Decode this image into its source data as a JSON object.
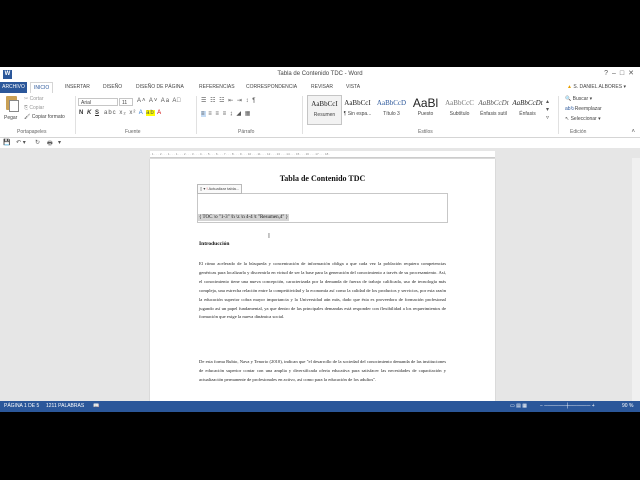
{
  "window": {
    "title": "Tabla de Contenido TDC - Word",
    "app_icon": "W"
  },
  "tabs": {
    "file": "ARCHIVO",
    "items": [
      "INICIO",
      "INSERTAR",
      "DISEÑO",
      "DISEÑO DE PÁGINA",
      "REFERENCIAS",
      "CORRESPONDENCIA",
      "REVISAR",
      "VISTA"
    ],
    "user": "S. DANIEL ALBORES"
  },
  "ribbon": {
    "clipboard": {
      "paste": "Pegar",
      "cut": "Cortar",
      "copy": "Copiar",
      "format_painter": "Copiar formato",
      "group": "Portapapeles"
    },
    "font": {
      "family": "Arial",
      "size": "11",
      "group": "Fuente",
      "bold": "N",
      "italic": "K",
      "underline": "S"
    },
    "paragraph": {
      "group": "Párrafo"
    },
    "styles": {
      "group": "Estilos",
      "items": [
        {
          "sample": "AaBbCcI",
          "name": "Resumen"
        },
        {
          "sample": "AaBbCcI",
          "name": "¶ Sin espa..."
        },
        {
          "sample": "AaBbCcD",
          "name": "Título 3"
        },
        {
          "sample": "AaBl",
          "name": "Puesto"
        },
        {
          "sample": "AaBbCcC",
          "name": "Subtítulo"
        },
        {
          "sample": "AaBbCcDt",
          "name": "Énfasis sutil"
        },
        {
          "sample": "AaBbCcDt",
          "name": "Énfasis"
        }
      ]
    },
    "editing": {
      "find": "Buscar",
      "replace": "Reemplazar",
      "select": "Seleccionar",
      "group": "Edición"
    }
  },
  "document": {
    "title": "Tabla de Contenido TDC",
    "toc_toolbar": "Actualizar tabla...",
    "toc_field": "{ TOC \\o \"1-3\" \\h \\z \\n 4-4 \\t \"Resumen,4\" }",
    "heading": "Introducción",
    "paragraphs": [
      "El ritmo acelerado de la búsqueda y concentración de información obliga a que cada vez la población requiera competencias genéricas para localizarla y discernirla en virtud de ser la base para la generación del conocimiento a través de su procesamiento. Así, el conocimiento tiene una nueva concepción, caracterizada por la demanda de fuerza de trabajo calificada, uso de tecnología más compleja, una estrecha relación entre la competitividad y la economía así como la calidad de los productos y servicios, por esta razón la educación superior cobra mayor importancia y la Universidad aún más, dado que ésta es proveedora de formación profesional jugando así un papel fundamental, ya que dentro de las principales demandas está responder con flexibilidad a los requerimientos de formación que exige la nueva dinámica social.",
      "De esta forma Rubio, Nava y Tenorio (2010), indican que \"el desarrollo de la sociedad del conocimiento demanda de las instituciones de educación superior contar con una amplia y diversificada oferta educativa para satisfacer las necesidades de capacitación y actualización permanente de profesionales en activo, así como para la educación de los adultos\"."
    ]
  },
  "status": {
    "page": "PÁGINA 1 DE 5",
    "words": "1211 PALABRAS",
    "zoom": "90 %"
  },
  "colors": {
    "accent": "#2b579a"
  }
}
